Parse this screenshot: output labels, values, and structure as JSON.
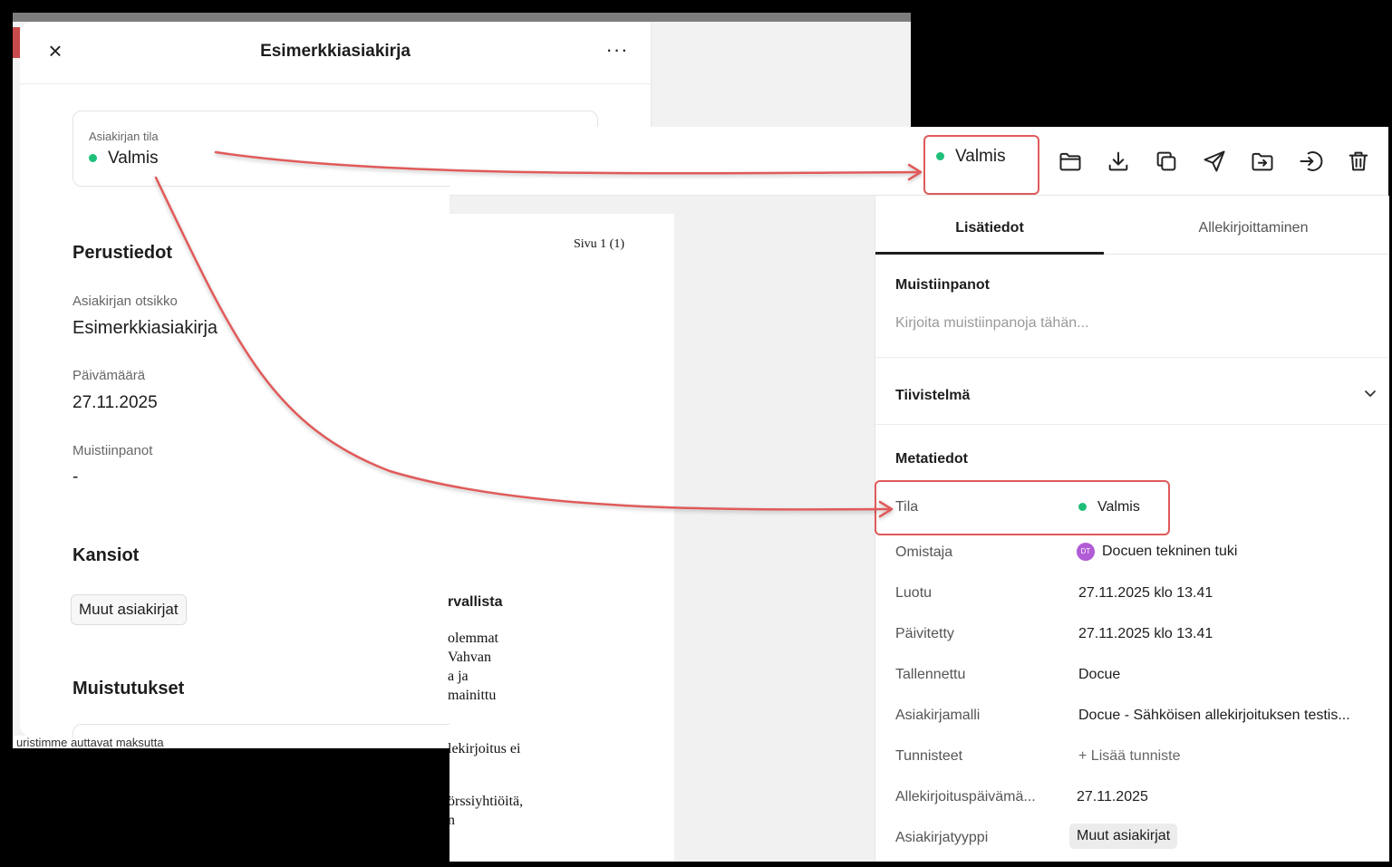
{
  "left": {
    "title": "Esimerkkiasiakirja",
    "status": {
      "label": "Asiakirjan tila",
      "value": "Valmis"
    },
    "basic": {
      "heading": "Perustiedot",
      "doc_title_label": "Asiakirjan otsikko",
      "doc_title_value": "Esimerkkiasiakirja",
      "date_label": "Päivämäärä",
      "date_value": "27.11.2025",
      "notes_label": "Muistiinpanot",
      "notes_value": "-"
    },
    "folders": {
      "heading": "Kansiot",
      "tag": "Muut asiakirjat"
    },
    "reminders": {
      "heading": "Muistutukset"
    },
    "peek_text": "uristimme auttavat maksutta"
  },
  "right": {
    "status_chip": "Valmis",
    "doc": {
      "page_label": "Sivu  1 (1)",
      "heading_fragment": "rvallista",
      "lines": [
        "olemmat",
        "Vahvan",
        "a ja",
        "mainittu",
        "lekirjoitus ei",
        "örssiyhtiöitä,",
        "n"
      ]
    },
    "tabs": [
      "Lisätiedot",
      "Allekirjoittaminen"
    ],
    "notes": {
      "heading": "Muistiinpanot",
      "placeholder": "Kirjoita muistiinpanoja tähän..."
    },
    "summary": {
      "heading": "Tiivistelmä"
    },
    "meta": {
      "heading": "Metatiedot",
      "rows": [
        {
          "key": "Tila",
          "value": "Valmis"
        },
        {
          "key": "Omistaja",
          "value": "Docuen tekninen tuki",
          "avatar": "DT"
        },
        {
          "key": "Luotu",
          "value": "27.11.2025 klo 13.41"
        },
        {
          "key": "Päivitetty",
          "value": "27.11.2025 klo 13.41"
        },
        {
          "key": "Tallennettu",
          "value": "Docue"
        },
        {
          "key": "Asiakirjamalli",
          "value": "Docue - Sähköisen allekirjoituksen testis..."
        },
        {
          "key": "Tunnisteet",
          "value": "+ Lisää tunniste"
        },
        {
          "key": "Allekirjoituspäivämä...",
          "value": "27.11.2025"
        },
        {
          "key": "Asiakirjatyyppi",
          "value": "Muut asiakirjat"
        }
      ]
    }
  },
  "colors": {
    "status_dot": "#1fbf78",
    "annotation": "#e05a5a",
    "avatar": "#b15bd6"
  },
  "icons": [
    "close-icon",
    "more-icon",
    "folder-icon",
    "download-icon",
    "copy-icon",
    "send-icon",
    "move-folder-icon",
    "login-icon",
    "trash-icon",
    "chevron-down-icon"
  ]
}
